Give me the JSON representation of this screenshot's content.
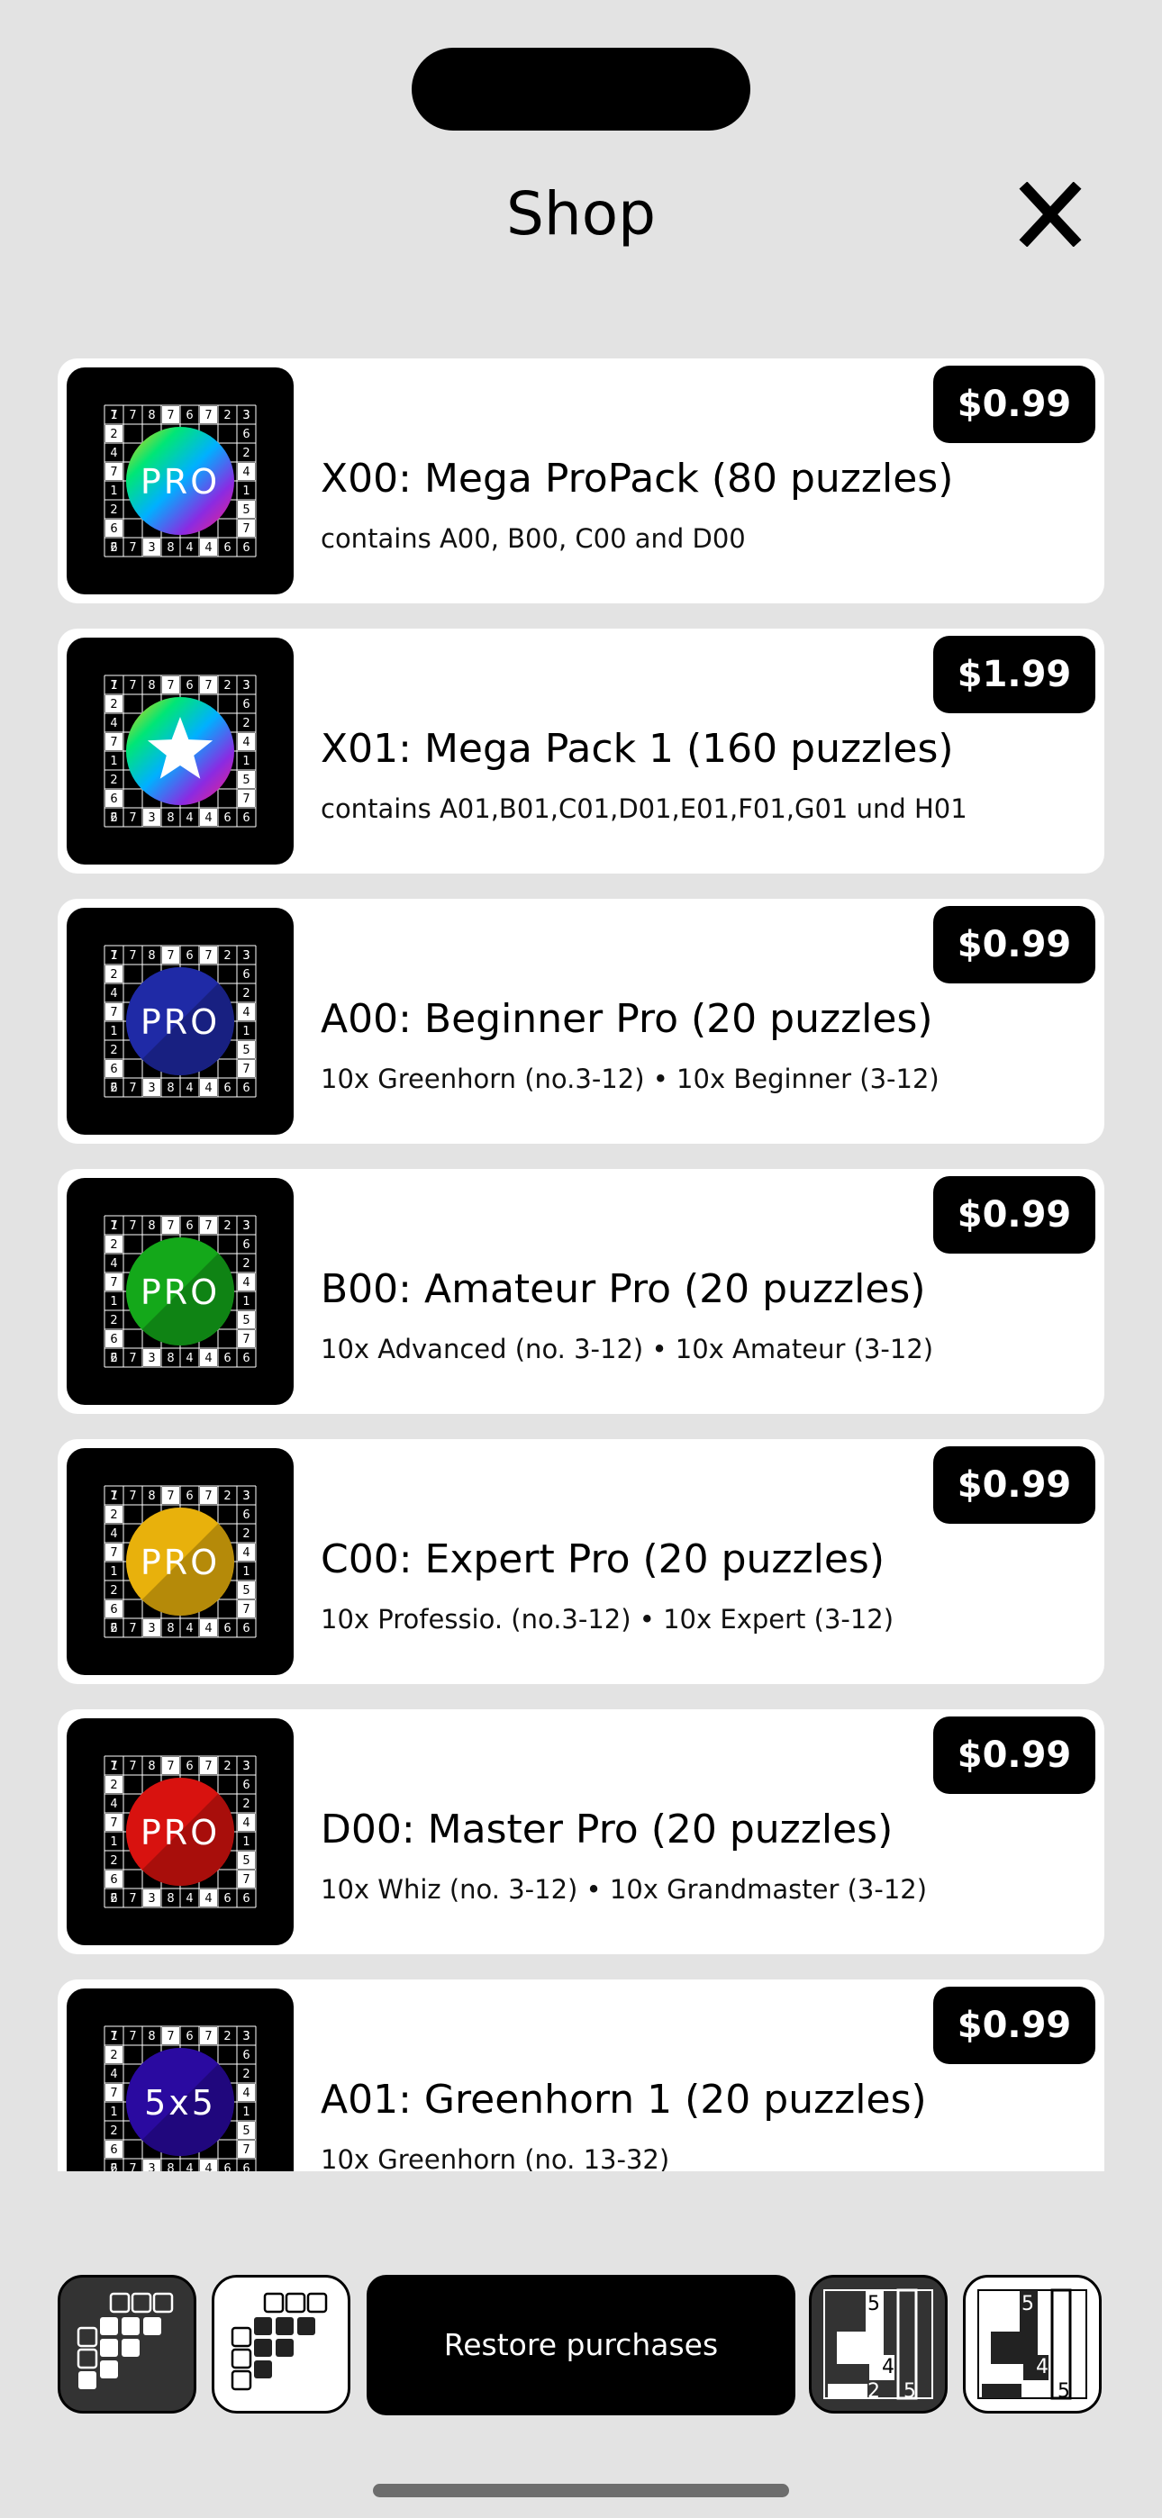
{
  "header": {
    "title": "Shop",
    "close_icon": "close-icon"
  },
  "colors": {
    "background": "#e3e3e3",
    "card": "#ffffff",
    "price_bg": "#000000",
    "price_text": "#ffffff"
  },
  "thumb_grid": {
    "top_row": [
      "1",
      "7",
      "8",
      "7",
      "6",
      "7",
      "2",
      "3"
    ],
    "left_col": [
      "7",
      "2",
      "4",
      "7",
      "1",
      "2",
      "6",
      "6"
    ],
    "right_col": [
      "3",
      "6",
      "2",
      "4",
      "1",
      "5",
      "7",
      "6"
    ],
    "bottom_row": [
      "2",
      "7",
      "3",
      "8",
      "4",
      "4",
      "6"
    ]
  },
  "products": [
    {
      "badge_text": "PRO",
      "badge_style": "rainbow",
      "price": "$0.99",
      "title": "X00: Mega ProPack (80 puzzles)",
      "subtitle": "contains A00, B00, C00 and D00"
    },
    {
      "badge_text": "",
      "badge_style": "rainbow-star",
      "price": "$1.99",
      "title": "X01: Mega Pack 1 (160 puzzles)",
      "subtitle": "contains A01,B01,C01,D01,E01,F01,G01 und H01"
    },
    {
      "badge_text": "PRO",
      "badge_style": "#1f2aa6",
      "price": "$0.99",
      "title": "A00: Beginner Pro (20 puzzles)",
      "subtitle": "10x Greenhorn (no.3-12) • 10x Beginner (3-12)"
    },
    {
      "badge_text": "PRO",
      "badge_style": "#14a81a",
      "price": "$0.99",
      "title": "B00: Amateur Pro (20 puzzles)",
      "subtitle": "10x Advanced (no. 3-12) • 10x Amateur (3-12)"
    },
    {
      "badge_text": "PRO",
      "badge_style": "#e8b10c",
      "price": "$0.99",
      "title": "C00: Expert Pro (20 puzzles)",
      "subtitle": "10x Professio. (no.3-12) • 10x Expert (3-12)"
    },
    {
      "badge_text": "PRO",
      "badge_style": "#d8120f",
      "price": "$0.99",
      "title": "D00: Master Pro (20 puzzles)",
      "subtitle": "10x Whiz (no. 3-12) • 10x Grandmaster (3-12)"
    },
    {
      "badge_text": "5x5",
      "badge_style": "#2a0aa0",
      "price": "$0.99",
      "title": "A01: Greenhorn 1 (20 puzzles)",
      "subtitle": "10x Greenhorn (no. 13-32)"
    }
  ],
  "toolbar": {
    "restore_label": "Restore purchases",
    "skyscraper_dark_icon": "skyscraper-grid-dark-icon",
    "skyscraper_light_icon": "skyscraper-grid-light-icon",
    "region_dark_icon": "region-puzzle-dark-icon",
    "region_light_icon": "region-puzzle-light-icon",
    "region_numbers": [
      "5",
      "4",
      "2",
      "5"
    ]
  }
}
